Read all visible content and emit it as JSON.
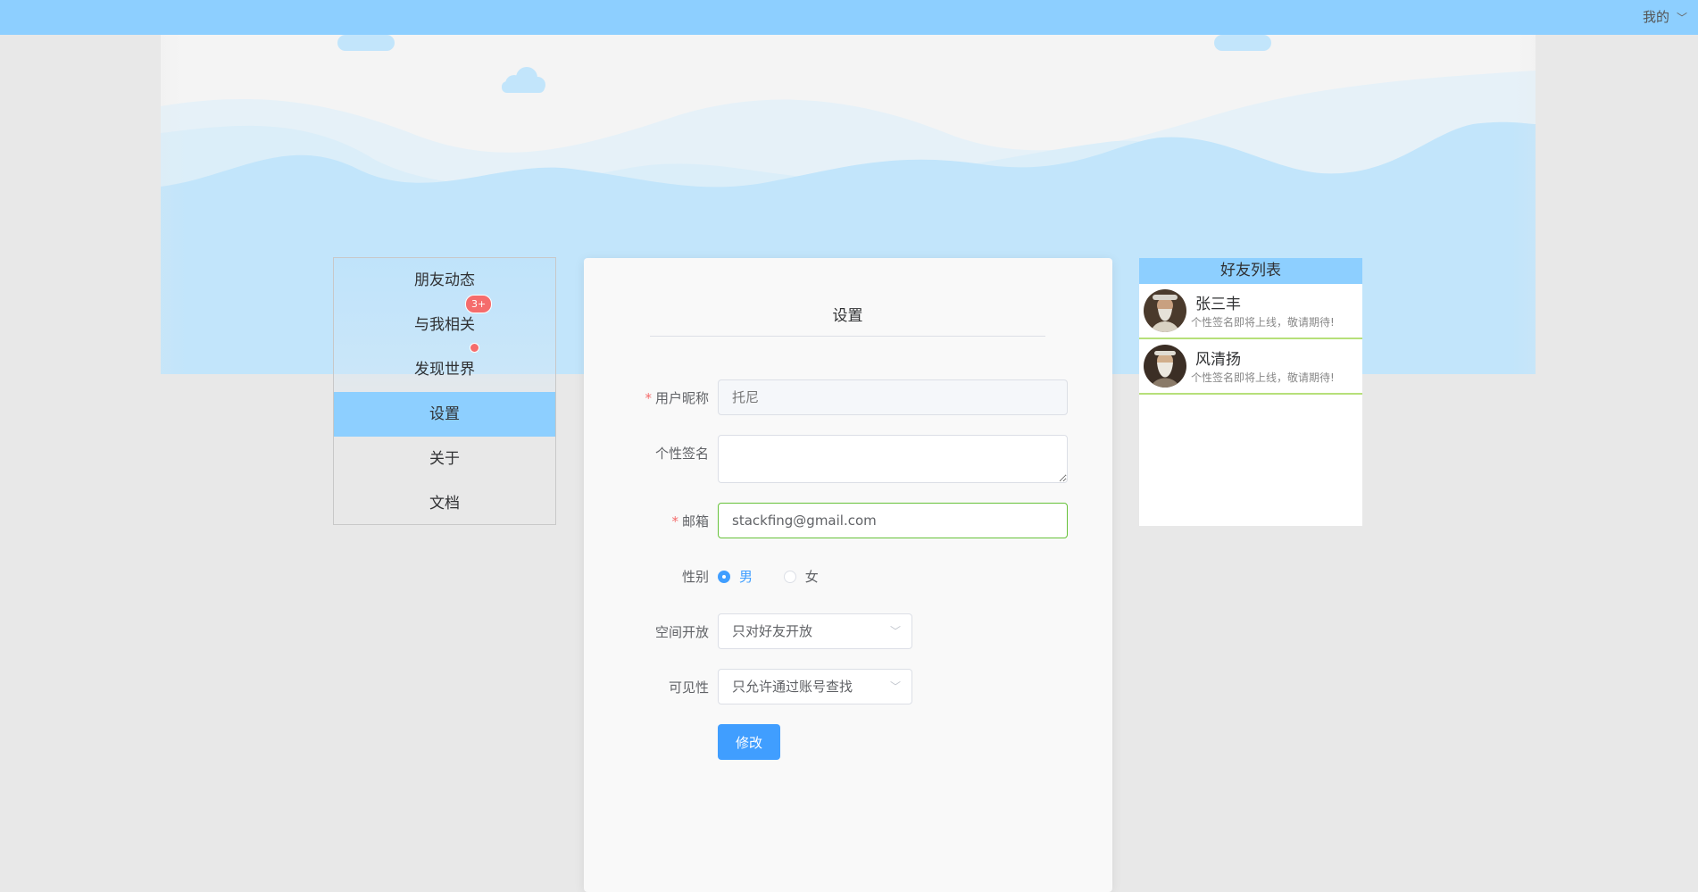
{
  "topbar": {
    "user_menu_label": "我的",
    "chevron_icon": "chevron-down-icon"
  },
  "nav": {
    "items": [
      {
        "label": "朋友动态"
      },
      {
        "label": "与我相关",
        "badge": "3+"
      },
      {
        "label": "发现世界",
        "dot": true
      },
      {
        "label": "设置",
        "active": true
      },
      {
        "label": "关于"
      },
      {
        "label": "文档"
      }
    ]
  },
  "settings": {
    "title": "设置",
    "nickname": {
      "label": "用户昵称",
      "required": "*",
      "placeholder": "托尼"
    },
    "signature": {
      "label": "个性签名",
      "value": ""
    },
    "email": {
      "label": "邮箱",
      "required": "*",
      "value": "stackfing@gmail.com"
    },
    "gender": {
      "label": "性别",
      "options": [
        "男",
        "女"
      ],
      "selected": "男"
    },
    "space_open": {
      "label": "空间开放",
      "value": "只对好友开放"
    },
    "visibility": {
      "label": "可见性",
      "value": "只允许通过账号查找"
    },
    "submit_label": "修改"
  },
  "friends": {
    "title": "好友列表",
    "list": [
      {
        "name": "张三丰",
        "signature": "个性签名即将上线，敬请期待!"
      },
      {
        "name": "风清扬",
        "signature": "个性签名即将上线，敬请期待!"
      }
    ]
  },
  "colors": {
    "accent": "#8dcfff",
    "primary": "#409eff",
    "danger": "#f56c6c",
    "success": "#67c23a"
  }
}
